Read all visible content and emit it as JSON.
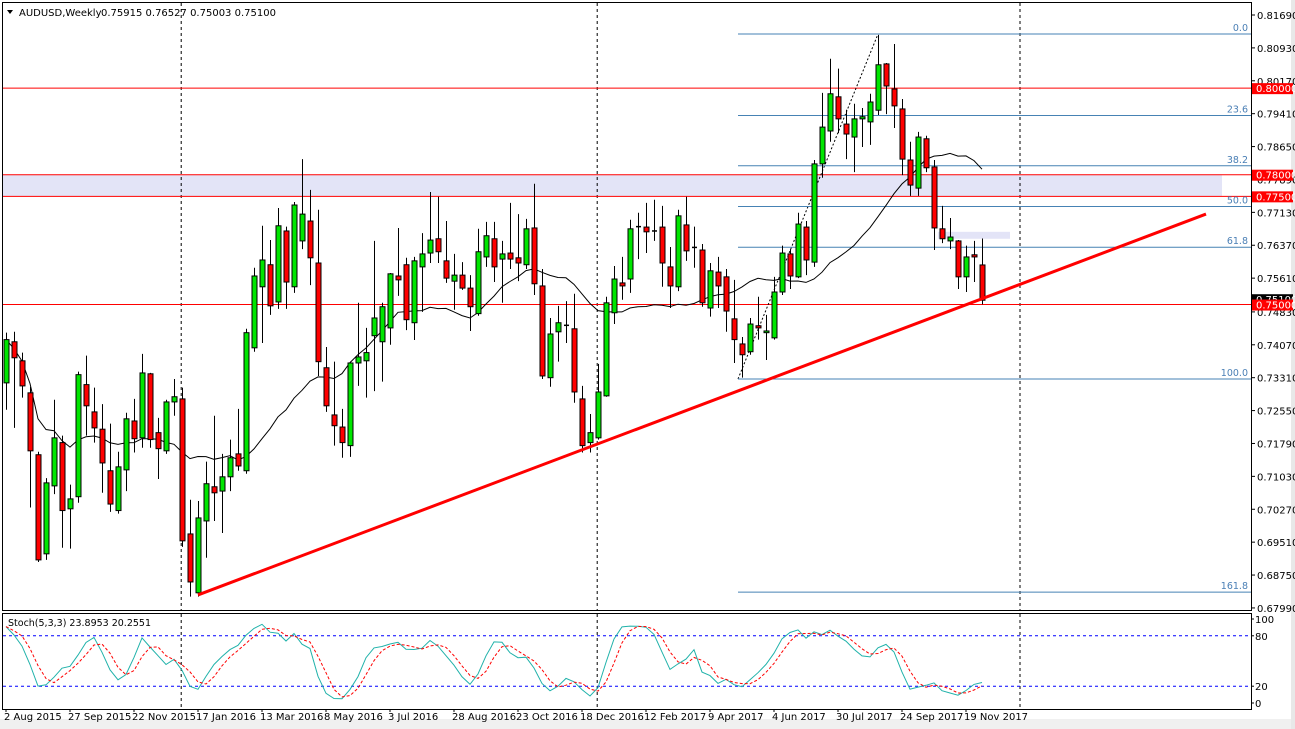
{
  "header": {
    "symbol_period": "AUDUSD,Weekly",
    "ohlc": "0.75915 0.76527 0.75003 0.75100"
  },
  "stoch_header": {
    "label": "Stoch(5,3,3) 23.8953 20.2551"
  },
  "colors": {
    "bull": "#00e600",
    "bear": "#ff0000",
    "level": "#ff0000",
    "fib": "#4682b4",
    "zone": "#e3e4f7",
    "stoch_main": "#20b2aa",
    "stoch_signal": "#ff0000",
    "stoch_levels": "#0000ff"
  },
  "chart_data": {
    "type": "candlestick",
    "title": "AUDUSD,Weekly",
    "ylim": [
      0.6799,
      0.8169
    ],
    "y_ticks": [
      "0.81690",
      "0.80930",
      "0.80170",
      "0.79410",
      "0.78650",
      "0.77890",
      "0.77130",
      "0.76370",
      "0.75610",
      "0.74830",
      "0.74070",
      "0.73310",
      "0.72550",
      "0.71790",
      "0.71030",
      "0.70270",
      "0.69510",
      "0.68750",
      "0.67990"
    ],
    "x_labels": [
      {
        "bar": 0,
        "label": "2 Aug 2015"
      },
      {
        "bar": 8,
        "label": "27 Sep 2015"
      },
      {
        "bar": 16,
        "label": "22 Nov 2015"
      },
      {
        "bar": 24,
        "label": "17 Jan 2016"
      },
      {
        "bar": 32,
        "label": "13 Mar 2016"
      },
      {
        "bar": 40,
        "label": "8 May 2016"
      },
      {
        "bar": 48,
        "label": "3 Jul 2016"
      },
      {
        "bar": 56,
        "label": "28 Aug 2016"
      },
      {
        "bar": 64,
        "label": "23 Oct 2016"
      },
      {
        "bar": 72,
        "label": "18 Dec 2016"
      },
      {
        "bar": 80,
        "label": "12 Feb 2017"
      },
      {
        "bar": 88,
        "label": "9 Apr 2017"
      },
      {
        "bar": 96,
        "label": "4 Jun 2017"
      },
      {
        "bar": 104,
        "label": "30 Jul 2017"
      },
      {
        "bar": 112,
        "label": "24 Sep 2017"
      },
      {
        "bar": 120,
        "label": "19 Nov 2017"
      }
    ],
    "period_separators": [
      21.9,
      73.9,
      126.75
    ],
    "candles_ohlc": [
      [
        0.7319,
        0.7435,
        0.7257,
        0.7419
      ],
      [
        0.7414,
        0.7437,
        0.7215,
        0.7377
      ],
      [
        0.737,
        0.7389,
        0.7285,
        0.7312
      ],
      [
        0.7296,
        0.731,
        0.7031,
        0.7162
      ],
      [
        0.7153,
        0.716,
        0.6905,
        0.691
      ],
      [
        0.6924,
        0.7099,
        0.691,
        0.7088
      ],
      [
        0.7081,
        0.728,
        0.7062,
        0.7192
      ],
      [
        0.7181,
        0.7197,
        0.6938,
        0.7024
      ],
      [
        0.7028,
        0.7084,
        0.6936,
        0.7051
      ],
      [
        0.7056,
        0.7345,
        0.7042,
        0.7338
      ],
      [
        0.7315,
        0.7382,
        0.7197,
        0.7266
      ],
      [
        0.7252,
        0.7308,
        0.7181,
        0.7215
      ],
      [
        0.7212,
        0.727,
        0.7065,
        0.7134
      ],
      [
        0.7116,
        0.7225,
        0.7021,
        0.7039
      ],
      [
        0.7024,
        0.716,
        0.7017,
        0.7125
      ],
      [
        0.7118,
        0.725,
        0.7069,
        0.7236
      ],
      [
        0.7231,
        0.7282,
        0.7158,
        0.719
      ],
      [
        0.7192,
        0.7386,
        0.7169,
        0.7342
      ],
      [
        0.734,
        0.7342,
        0.7169,
        0.7188
      ],
      [
        0.7204,
        0.7238,
        0.7097,
        0.7167
      ],
      [
        0.7162,
        0.728,
        0.7155,
        0.7275
      ],
      [
        0.7275,
        0.7328,
        0.7243,
        0.7287
      ],
      [
        0.7282,
        0.7308,
        0.694,
        0.6954
      ],
      [
        0.697,
        0.7049,
        0.6825,
        0.6859
      ],
      [
        0.6834,
        0.7046,
        0.6825,
        0.7007
      ],
      [
        0.7,
        0.7137,
        0.6915,
        0.7086
      ],
      [
        0.7079,
        0.7243,
        0.7,
        0.7065
      ],
      [
        0.7069,
        0.7155,
        0.6972,
        0.7102
      ],
      [
        0.7102,
        0.7188,
        0.7069,
        0.7146
      ],
      [
        0.7155,
        0.7259,
        0.7116,
        0.7127
      ],
      [
        0.7116,
        0.7444,
        0.7109,
        0.7435
      ],
      [
        0.74,
        0.7585,
        0.7391,
        0.7566
      ],
      [
        0.7541,
        0.7682,
        0.7411,
        0.7603
      ],
      [
        0.7592,
        0.7649,
        0.7476,
        0.7497
      ],
      [
        0.7506,
        0.7723,
        0.749,
        0.7682
      ],
      [
        0.767,
        0.768,
        0.749,
        0.7552
      ],
      [
        0.7541,
        0.7737,
        0.7527,
        0.773
      ],
      [
        0.7647,
        0.7836,
        0.7628,
        0.7709
      ],
      [
        0.7693,
        0.7765,
        0.7545,
        0.7608
      ],
      [
        0.7596,
        0.7719,
        0.7335,
        0.7368
      ],
      [
        0.7354,
        0.7402,
        0.7252,
        0.7266
      ],
      [
        0.7245,
        0.7368,
        0.7174,
        0.722
      ],
      [
        0.7217,
        0.7259,
        0.7146,
        0.7181
      ],
      [
        0.7174,
        0.7368,
        0.7148,
        0.7365
      ],
      [
        0.7365,
        0.7504,
        0.7312,
        0.7379
      ],
      [
        0.737,
        0.7446,
        0.7285,
        0.7389
      ],
      [
        0.7428,
        0.7647,
        0.73,
        0.7469
      ],
      [
        0.7414,
        0.7504,
        0.7322,
        0.7495
      ],
      [
        0.7446,
        0.7573,
        0.7407,
        0.7571
      ],
      [
        0.7566,
        0.7677,
        0.752,
        0.7557
      ],
      [
        0.7592,
        0.7608,
        0.7441,
        0.7465
      ],
      [
        0.7458,
        0.761,
        0.7418,
        0.7601
      ],
      [
        0.7587,
        0.7665,
        0.7483,
        0.7617
      ],
      [
        0.7619,
        0.776,
        0.7596,
        0.7649
      ],
      [
        0.7652,
        0.7749,
        0.7596,
        0.7622
      ],
      [
        0.7601,
        0.7693,
        0.755,
        0.7561
      ],
      [
        0.7554,
        0.7617,
        0.7488,
        0.7568
      ],
      [
        0.7568,
        0.7598,
        0.7534,
        0.7538
      ],
      [
        0.7538,
        0.7568,
        0.7439,
        0.7495
      ],
      [
        0.7479,
        0.7675,
        0.7474,
        0.7622
      ],
      [
        0.761,
        0.7691,
        0.7587,
        0.7659
      ],
      [
        0.7652,
        0.7691,
        0.7552,
        0.7587
      ],
      [
        0.7605,
        0.7647,
        0.7504,
        0.7617
      ],
      [
        0.7619,
        0.7735,
        0.7582,
        0.7605
      ],
      [
        0.7608,
        0.7709,
        0.7554,
        0.7596
      ],
      [
        0.7592,
        0.7698,
        0.7582,
        0.7675
      ],
      [
        0.7677,
        0.7779,
        0.7522,
        0.7548
      ],
      [
        0.7543,
        0.7582,
        0.7328,
        0.7335
      ],
      [
        0.7331,
        0.7469,
        0.731,
        0.7432
      ],
      [
        0.7437,
        0.7497,
        0.7368,
        0.7458
      ],
      [
        0.7451,
        0.7508,
        0.7411,
        0.7452
      ],
      [
        0.7444,
        0.7525,
        0.7273,
        0.7298
      ],
      [
        0.7282,
        0.7312,
        0.7158,
        0.7174
      ],
      [
        0.7181,
        0.7247,
        0.7158,
        0.7204
      ],
      [
        0.7192,
        0.7363,
        0.7188,
        0.7298
      ],
      [
        0.7289,
        0.7518,
        0.7287,
        0.7504
      ],
      [
        0.7481,
        0.7589,
        0.7455,
        0.7559
      ],
      [
        0.755,
        0.761,
        0.7511,
        0.7543
      ],
      [
        0.7559,
        0.7696,
        0.7527,
        0.7675
      ],
      [
        0.7679,
        0.7712,
        0.7605,
        0.768
      ],
      [
        0.7679,
        0.7735,
        0.7619,
        0.7668
      ],
      [
        0.767,
        0.7742,
        0.7647,
        0.7669
      ],
      [
        0.7679,
        0.7728,
        0.7541,
        0.7596
      ],
      [
        0.7587,
        0.7633,
        0.7492,
        0.7543
      ],
      [
        0.7541,
        0.7719,
        0.7531,
        0.7705
      ],
      [
        0.7684,
        0.7749,
        0.7601,
        0.7624
      ],
      [
        0.7631,
        0.768,
        0.7585,
        0.7632
      ],
      [
        0.7626,
        0.764,
        0.7495,
        0.7504
      ],
      [
        0.7492,
        0.7596,
        0.7472,
        0.7578
      ],
      [
        0.7575,
        0.761,
        0.7492,
        0.7543
      ],
      [
        0.7564,
        0.7582,
        0.7437,
        0.7485
      ],
      [
        0.7467,
        0.7557,
        0.7365,
        0.7419
      ],
      [
        0.7409,
        0.7425,
        0.7331,
        0.7384
      ],
      [
        0.7391,
        0.7469,
        0.7384,
        0.7455
      ],
      [
        0.7451,
        0.7518,
        0.7419,
        0.7446
      ],
      [
        0.7435,
        0.7476,
        0.7372,
        0.7439
      ],
      [
        0.7423,
        0.7564,
        0.7419,
        0.7529
      ],
      [
        0.7529,
        0.7636,
        0.7522,
        0.7619
      ],
      [
        0.7617,
        0.7628,
        0.7536,
        0.7566
      ],
      [
        0.7564,
        0.7712,
        0.7561,
        0.7686
      ],
      [
        0.7679,
        0.7693,
        0.7568,
        0.7603
      ],
      [
        0.7598,
        0.7834,
        0.7587,
        0.7825
      ],
      [
        0.7825,
        0.7989,
        0.7793,
        0.791
      ],
      [
        0.7901,
        0.8068,
        0.7876,
        0.7987
      ],
      [
        0.798,
        0.8045,
        0.7896,
        0.7929
      ],
      [
        0.7917,
        0.795,
        0.7836,
        0.7894
      ],
      [
        0.7887,
        0.7964,
        0.7806,
        0.7929
      ],
      [
        0.7929,
        0.7954,
        0.7864,
        0.7934
      ],
      [
        0.7922,
        0.7987,
        0.7869,
        0.7968
      ],
      [
        0.7949,
        0.8123,
        0.7938,
        0.8054
      ],
      [
        0.8056,
        0.8058,
        0.794,
        0.8005
      ],
      [
        0.7998,
        0.8102,
        0.7908,
        0.7959
      ],
      [
        0.7952,
        0.7975,
        0.7799,
        0.7836
      ],
      [
        0.7834,
        0.7876,
        0.7751,
        0.7776
      ],
      [
        0.7769,
        0.7899,
        0.7751,
        0.7887
      ],
      [
        0.7883,
        0.789,
        0.7806,
        0.7816
      ],
      [
        0.7818,
        0.7834,
        0.7626,
        0.7677
      ],
      [
        0.7675,
        0.7728,
        0.7642,
        0.7652
      ],
      [
        0.7647,
        0.77,
        0.7628,
        0.7656
      ],
      [
        0.7647,
        0.7649,
        0.7536,
        0.7564
      ],
      [
        0.7564,
        0.7636,
        0.7529,
        0.761
      ],
      [
        0.7615,
        0.7647,
        0.7552,
        0.761
      ],
      [
        0.75915,
        0.76527,
        0.75003,
        0.751
      ]
    ],
    "horizontal_levels": [
      {
        "price": 0.8,
        "label": "0.80000"
      },
      {
        "price": 0.78,
        "label": "0.78000"
      },
      {
        "price": 0.775,
        "label": "0.77500"
      },
      {
        "price": 0.75,
        "label": "0.75000"
      }
    ],
    "current_price": {
      "price": 0.751,
      "label": "0.75100"
    },
    "zones": [
      {
        "from_bar": -1,
        "to_bar": 152,
        "low": 0.775,
        "high": 0.78
      },
      {
        "from_bar": 116.5,
        "to_bar": 125.5,
        "low": 0.7652,
        "high": 0.7668
      }
    ],
    "trendline": {
      "start": {
        "bar": 24,
        "price": 0.6829
      },
      "end": {
        "bar": 150,
        "price": 0.7709
      }
    },
    "fibonacci": {
      "from": {
        "bar": 91.5,
        "price": 0.7328
      },
      "to": {
        "bar": 109,
        "price": 0.8125
      },
      "end_bar": 155,
      "levels": [
        {
          "ratio": 0.0,
          "label": "0.0"
        },
        {
          "ratio": 0.236,
          "label": "23.6"
        },
        {
          "ratio": 0.382,
          "label": "38.2"
        },
        {
          "ratio": 0.5,
          "label": "50.0"
        },
        {
          "ratio": 0.618,
          "label": "61.8"
        },
        {
          "ratio": 1.0,
          "label": "100.0"
        },
        {
          "ratio": 1.618,
          "label": "161.8"
        }
      ]
    },
    "stochastic": {
      "k": 5,
      "d": 3,
      "slowing": 3,
      "levels": [
        20,
        80
      ],
      "axis_labels": [
        "100",
        "80",
        "20",
        "0"
      ],
      "ylim": [
        0,
        100
      ]
    }
  }
}
